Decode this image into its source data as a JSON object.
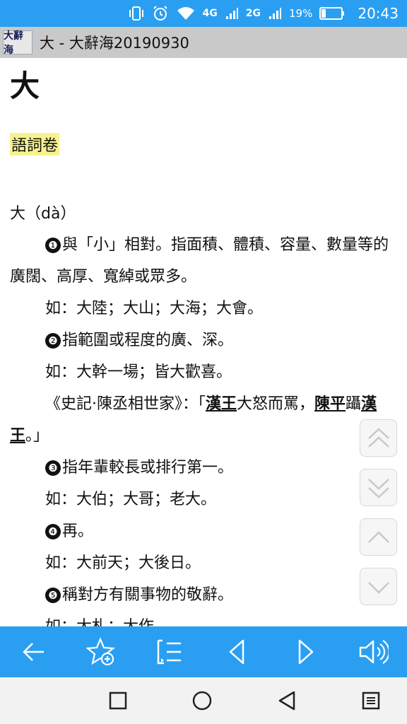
{
  "status_bar": {
    "network_4g": "4G",
    "network_2g": "2G",
    "battery": "19%",
    "time": "20:43",
    "icons": [
      "vibrate-icon",
      "alarm-icon",
      "wifi-icon",
      "signal-icon",
      "battery-icon"
    ]
  },
  "title_bar": {
    "logo_text": "大辭海",
    "title": "大 - 大辭海20190930"
  },
  "entry": {
    "headword": "大",
    "volume": "語詞卷",
    "pronunciation": "大（dà）",
    "senses": [
      {
        "num": "❶",
        "def": "與「小」相對。指面積、體積、容量、數量等的廣闊、高厚、寬綽或眾多。",
        "example": "如：大陸；大山；大海；大會。"
      },
      {
        "num": "❷",
        "def": "指範圍或程度的廣、深。",
        "example": "如：大幹一場；皆大歡喜。",
        "quote": {
          "pre": "《史記·陳丞相世家》：「",
          "link1": "漢王",
          "mid": "大怒而罵，",
          "link2": "陳平",
          "mid2": "躡",
          "link3": "漢王",
          "post": "。」"
        }
      },
      {
        "num": "❸",
        "def": "指年輩較長或排行第一。",
        "example": "如：大伯；大哥；老大。"
      },
      {
        "num": "❹",
        "def": "再。",
        "example": "如：大前天；大後日。"
      },
      {
        "num": "❺",
        "def": "稱對方有關事物的敬辭。",
        "example": "如：大札；大作。"
      }
    ]
  },
  "scroll_buttons": [
    "page-up",
    "page-down",
    "line-up",
    "line-down"
  ],
  "toolbar": [
    "back",
    "add-favorite",
    "list",
    "previous",
    "next",
    "speak"
  ],
  "navbar": [
    "recent-apps",
    "home",
    "back",
    "menu"
  ],
  "colors": {
    "accent": "#2a9ff2",
    "highlight": "#f7f28e",
    "title_bar": "#c9c9c9"
  }
}
